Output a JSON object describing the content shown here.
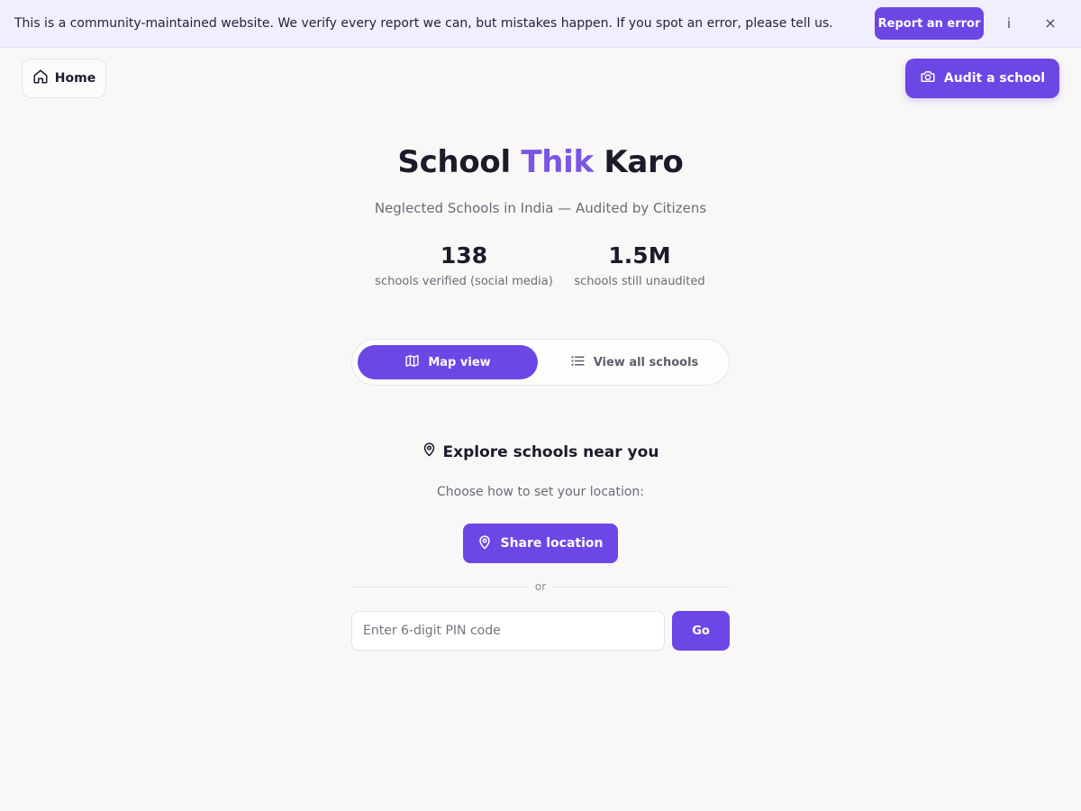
{
  "banner": {
    "text": "This is a community-maintained website. We verify every report we can, but mistakes happen. If you spot an error, please tell us.",
    "report_label": "Report an error",
    "info_label": "i",
    "close_label": "×"
  },
  "nav": {
    "home_label": "Home",
    "audit_label": "Audit a school"
  },
  "hero": {
    "title_part1": "School",
    "title_accent": "Thik",
    "title_part2": "Karo",
    "subtitle": "Neglected Schools in India — Audited by Citizens",
    "stats": [
      {
        "value": "138",
        "label": "schools verified (social media)"
      },
      {
        "value": "1.5M",
        "label": "schools still unaudited"
      }
    ]
  },
  "toggle": {
    "map_label": "Map view",
    "list_label": "View all schools",
    "selected": "map"
  },
  "explore": {
    "heading": "Explore schools near you",
    "subtext": "Choose how to set your location:",
    "share_label": "Share location",
    "divider": "or",
    "pin_placeholder": "Enter 6-digit PIN code",
    "pin_value": "",
    "go_label": "Go"
  },
  "icons": {
    "home": "home-icon",
    "audit": "camera-icon",
    "map_view": "map-icon",
    "list_view": "list-icon",
    "explore": "map-pin-icon",
    "share": "map-pin-icon"
  },
  "colors": {
    "accent": "#6c47e5",
    "title_accent": "#7b55e3",
    "banner_bg": "#f1effd",
    "page_bg": "#f9f8f7",
    "text_muted": "#6b6a78"
  }
}
